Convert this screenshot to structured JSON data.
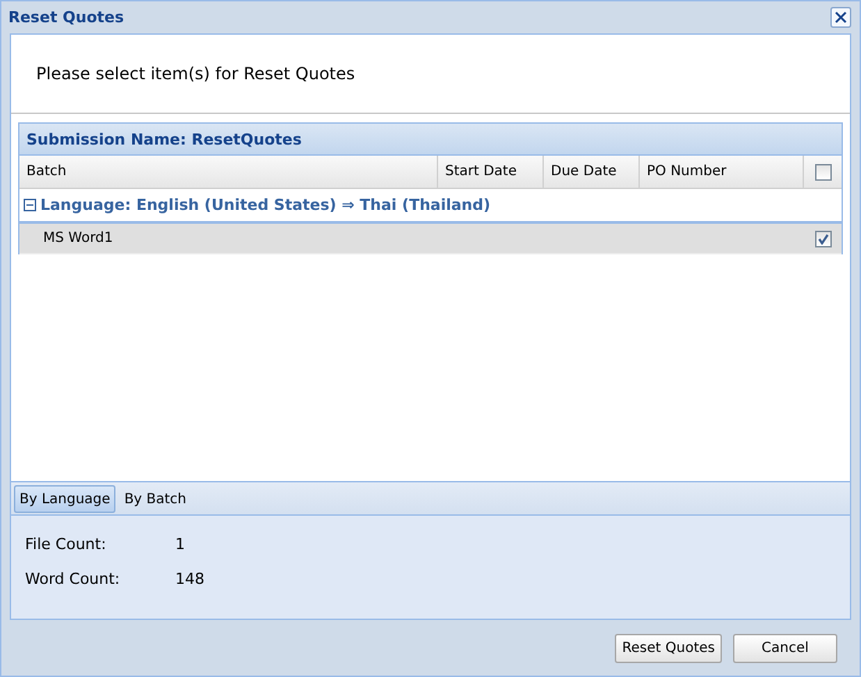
{
  "window": {
    "title": "Reset Quotes"
  },
  "instruction": "Please select item(s) for Reset Quotes",
  "grid": {
    "title": "Submission Name: ResetQuotes",
    "columns": [
      "Batch",
      "Start Date",
      "Due Date",
      "PO Number"
    ],
    "header_checked": false,
    "groups": [
      {
        "label": "Language: English (United States) ⇒ Thai (Thailand)",
        "expanded": true,
        "rows": [
          {
            "batch": "MS Word1",
            "checked": true,
            "selected": true
          }
        ]
      }
    ]
  },
  "tabs": [
    {
      "label": "By Language",
      "selected": true
    },
    {
      "label": "By Batch",
      "selected": false
    }
  ],
  "stats": [
    {
      "label": "File Count:",
      "value": "1"
    },
    {
      "label": "Word Count:",
      "value": "148"
    }
  ],
  "buttons": [
    "Reset Quotes",
    "Cancel"
  ]
}
